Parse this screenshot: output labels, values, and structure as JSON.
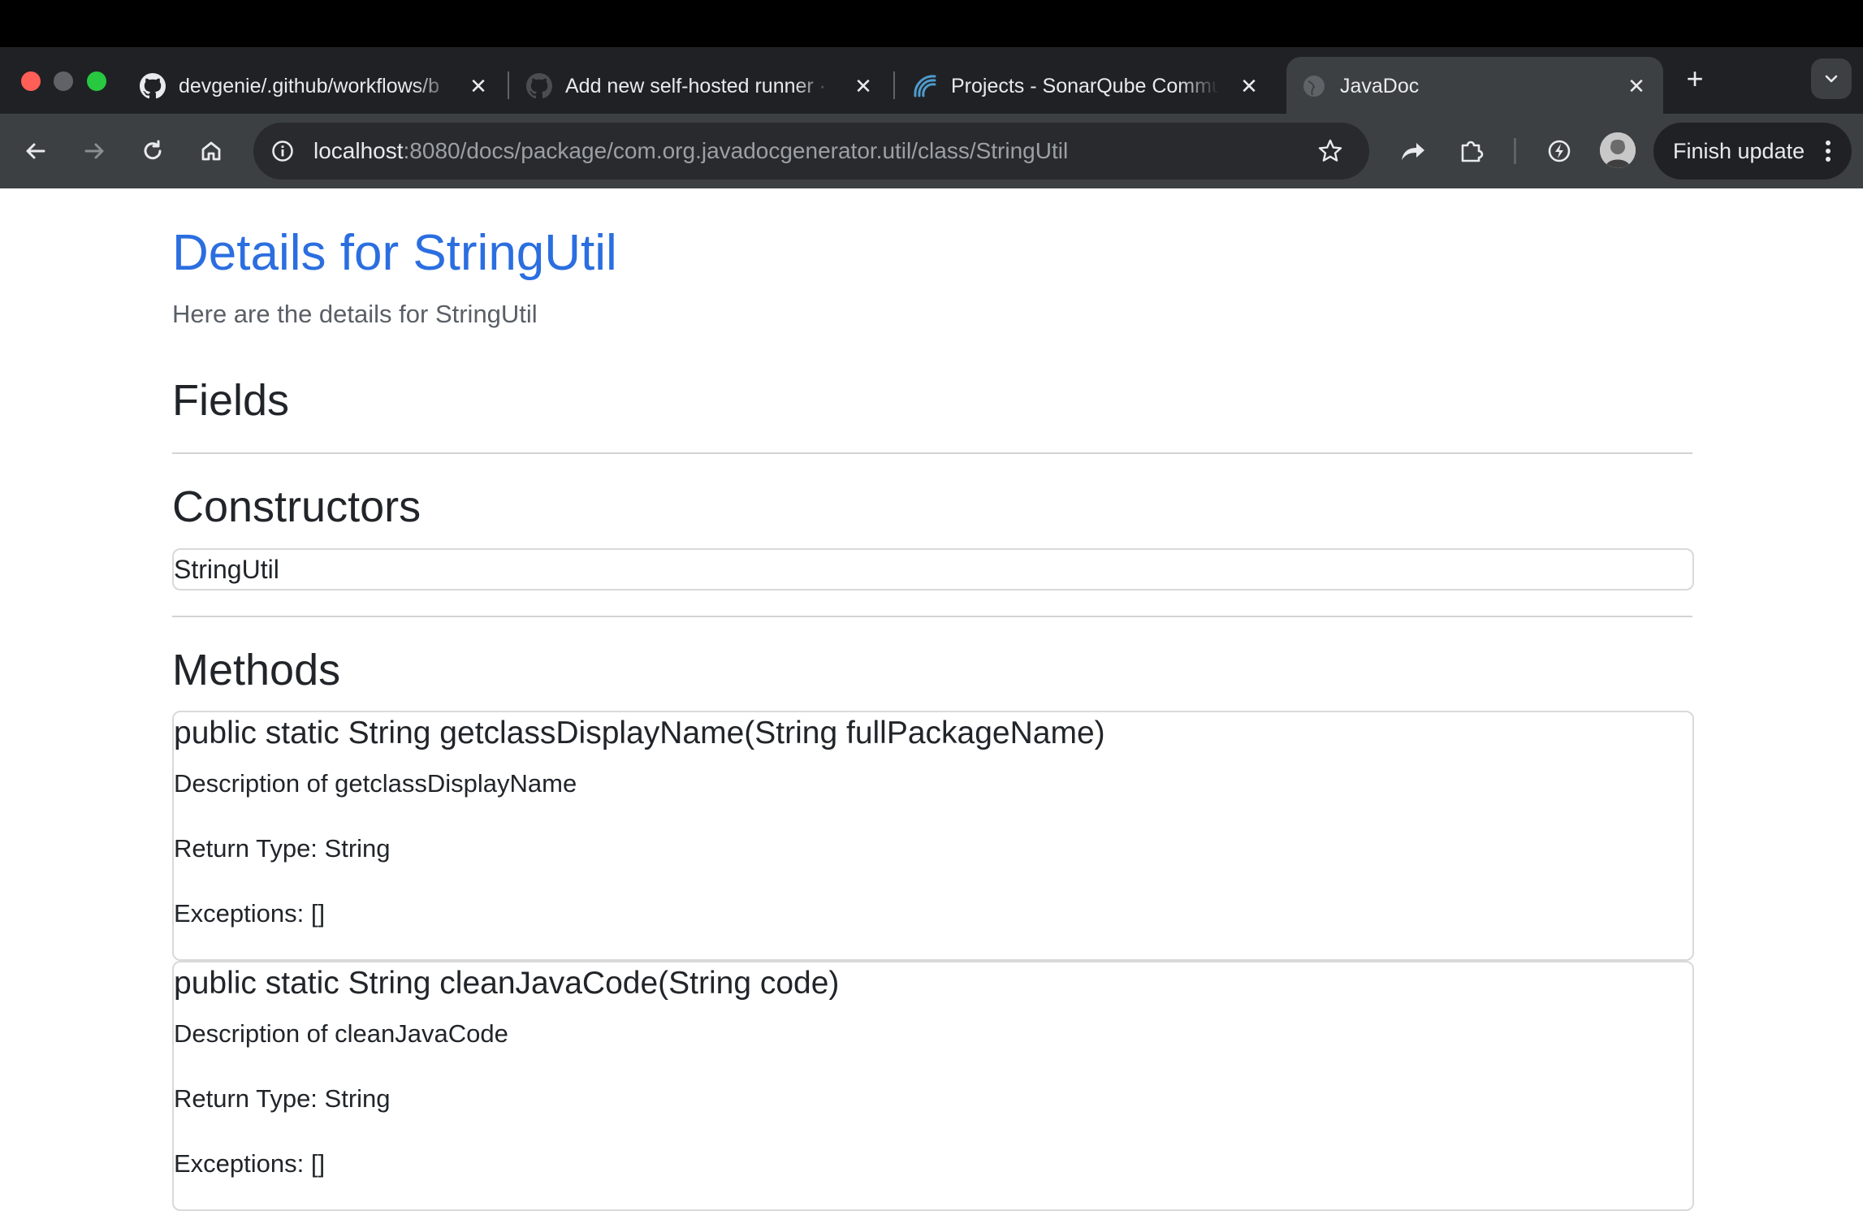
{
  "browser": {
    "tabs": [
      {
        "title": "devgenie/.github/workflows/b",
        "icon": "github-icon"
      },
      {
        "title": "Add new self-hosted runner ·",
        "icon": "github-icon"
      },
      {
        "title": "Projects - SonarQube Commu",
        "icon": "sonarqube-icon"
      },
      {
        "title": "JavaDoc",
        "icon": "globe-icon",
        "active": true
      }
    ],
    "url_host": "localhost",
    "url_rest": ":8080/docs/package/com.org.javadocgenerator.util/class/StringUtil",
    "finish_update_label": "Finish update"
  },
  "page": {
    "title": "Details for StringUtil",
    "subtitle": "Here are the details for StringUtil",
    "fields_heading": "Fields",
    "constructors_heading": "Constructors",
    "constructors": [
      "StringUtil"
    ],
    "methods_heading": "Methods",
    "methods": [
      {
        "signature": "public static String getclassDisplayName(String fullPackageName)",
        "description": "Description of getclassDisplayName",
        "return_type": "Return Type: String",
        "exceptions": "Exceptions: []"
      },
      {
        "signature": "public static String cleanJavaCode(String code)",
        "description": "Description of cleanJavaCode",
        "return_type": "Return Type: String",
        "exceptions": "Exceptions: []"
      }
    ]
  },
  "colors": {
    "title_blue": "#2b6ee0",
    "tab_bar": "#202124",
    "toolbar": "#3c4043"
  }
}
